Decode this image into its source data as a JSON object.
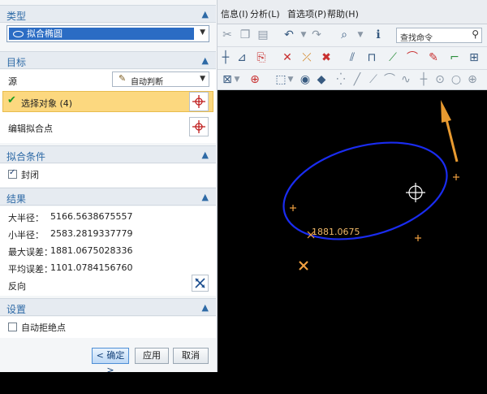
{
  "dialog": {
    "type_section": {
      "title": "类型",
      "selected": "拟合椭圆"
    },
    "target_section": {
      "title": "目标",
      "source_label": "源",
      "source_value": "自动判断",
      "select_object": "选择对象 (4)",
      "edit_fit_points": "编辑拟合点"
    },
    "fit_conditions": {
      "title": "拟合条件",
      "closed_label": "封闭",
      "closed_checked": true
    },
    "results": {
      "title": "结果",
      "rows": [
        {
          "label": "大半径：",
          "value": "5166.5638675557"
        },
        {
          "label": "小半径：",
          "value": "2583.2819337779"
        },
        {
          "label": "最大误差：",
          "value": "1881.0675028336"
        },
        {
          "label": "平均误差：",
          "value": "1101.0784156760"
        }
      ],
      "reverse_label": "反向"
    },
    "settings": {
      "title": "设置",
      "auto_reject_label": "自动拒绝点",
      "auto_reject_checked": false
    },
    "buttons": {
      "ok": "< 确定 >",
      "apply": "应用",
      "cancel": "取消"
    }
  },
  "menubar": {
    "items": [
      "信息(I)",
      "分析(L)",
      "首选项(P)",
      "帮助(H)"
    ]
  },
  "toolbar": {
    "search_placeholder": "查找命令"
  },
  "canvas": {
    "dimension_label": "1881.0675",
    "ellipse_color": "#1a2cf0",
    "point_color": "#f0a040",
    "background": "#000000"
  },
  "colors": {
    "accent": "#2e6aa6",
    "selected_row": "#fcd87f",
    "selection_blue": "#2b6cc4"
  }
}
